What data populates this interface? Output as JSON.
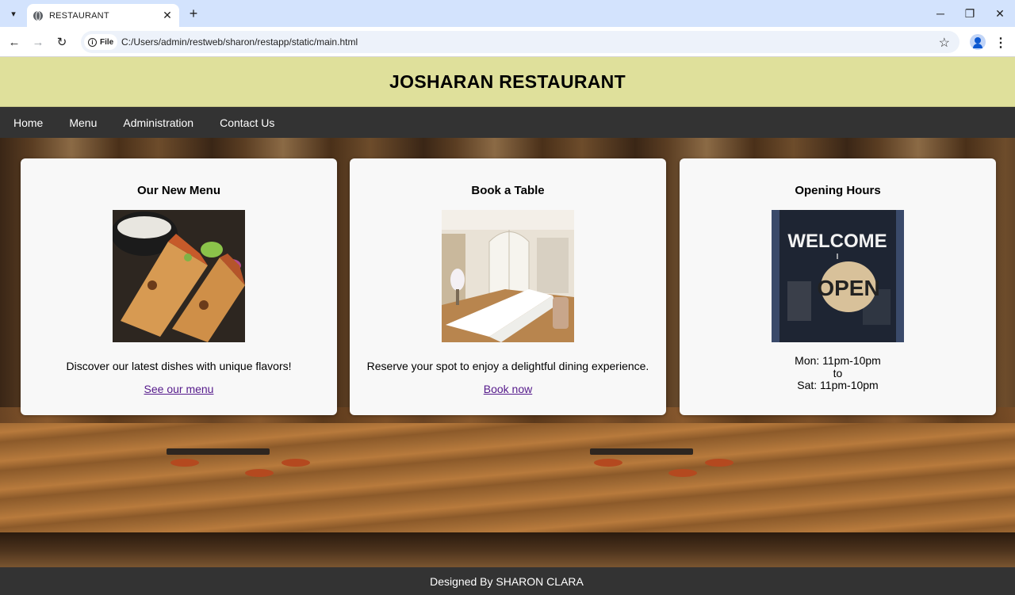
{
  "browser": {
    "tab_title": "RESTAURANT",
    "url_chip": "File",
    "url": "C:/Users/admin/restweb/sharon/restapp/static/main.html"
  },
  "site": {
    "title": "JOSHARAN RESTAURANT",
    "nav": [
      "Home",
      "Menu",
      "Administration",
      "Contact Us"
    ]
  },
  "cards": [
    {
      "title": "Our New Menu",
      "text": "Discover our latest dishes with unique flavors!",
      "link": "See our menu",
      "image": "wraps-food-image"
    },
    {
      "title": "Book a Table",
      "text": "Reserve your spot to enjoy a delightful dining experience.",
      "link": "Book now",
      "image": "dining-room-image"
    },
    {
      "title": "Opening Hours",
      "hours_open": "Mon: 11pm-10pm",
      "hours_to": "to",
      "hours_close": "Sat: 11pm-10pm",
      "image": "open-sign-image",
      "sign_welcome": "WELCOME",
      "sign_open": "OPEN"
    }
  ],
  "footer": {
    "text": "Designed By SHARON CLARA"
  }
}
